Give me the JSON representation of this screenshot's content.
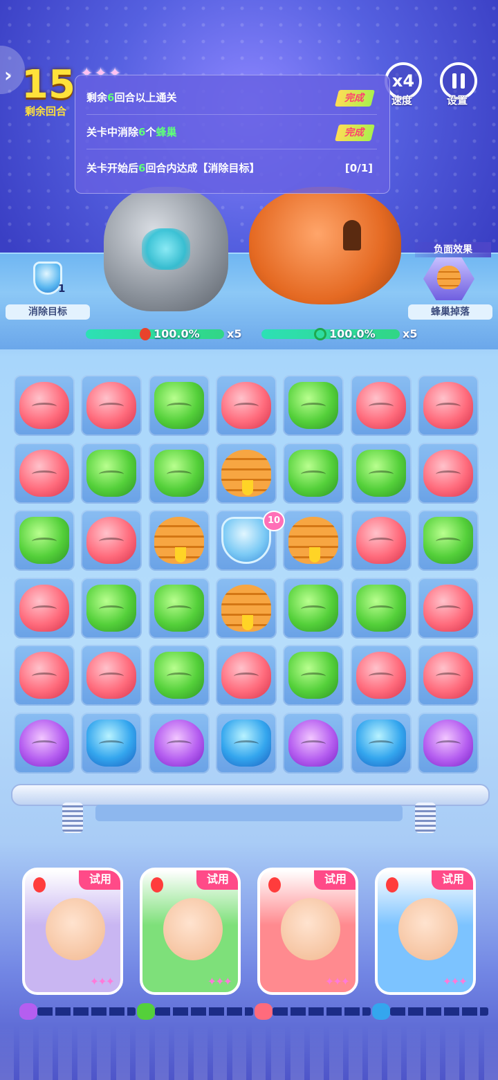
{
  "hud": {
    "turns_remaining": "15",
    "turns_label": "剩余回合",
    "speed_value": "x4",
    "speed_label": "速度",
    "settings_label": "设置"
  },
  "objectives": [
    {
      "pre": "剩余",
      "num": "6",
      "post": "回合以上通关",
      "status": "完成"
    },
    {
      "pre": "关卡中消除",
      "num": "6",
      "mid": "个",
      "hl_word": "蜂巢",
      "status": "完成"
    },
    {
      "pre": "关卡开始后",
      "num": "6",
      "post": "回合内达成【消除目标】",
      "status": "[0/1]"
    }
  ],
  "arena": {
    "left_goal_label": "消除目标",
    "left_goal_count": "1",
    "debuff_title": "负面效果",
    "debuff_label": "蜂巢掉落",
    "enemy1_hp_text": "100.0%",
    "enemy1_mult": "x5",
    "enemy1_hp_fraction": 1.0,
    "enemy2_hp_text": "100.0%",
    "enemy2_mult": "x5",
    "enemy2_hp_fraction": 1.0
  },
  "board": {
    "rows": [
      [
        "red",
        "red",
        "green",
        "red",
        "green",
        "red",
        "red"
      ],
      [
        "red",
        "green",
        "green",
        "hive",
        "green",
        "green",
        "red"
      ],
      [
        "green",
        "red",
        "hive",
        "shield",
        "hive",
        "red",
        "green"
      ],
      [
        "red",
        "green",
        "green",
        "hive",
        "green",
        "green",
        "red"
      ],
      [
        "red",
        "red",
        "green",
        "red",
        "green",
        "red",
        "red"
      ],
      [
        "purple",
        "blue",
        "purple",
        "blue",
        "purple",
        "blue",
        "purple"
      ]
    ],
    "shield_badge": "10"
  },
  "heroes": [
    {
      "trial": "试用",
      "bg": "#c9b6f2",
      "energy_icon": "purple"
    },
    {
      "trial": "试用",
      "bg": "#7ee07a",
      "energy_icon": "green"
    },
    {
      "trial": "试用",
      "bg": "#ff8a8f",
      "energy_icon": "red"
    },
    {
      "trial": "试用",
      "bg": "#7cc3ff",
      "energy_icon": "blue"
    }
  ],
  "colors": {
    "red": "#ff6b7c",
    "green": "#54d03a",
    "purple": "#b55ef0",
    "blue": "#34a6ee",
    "trial_badge": "#ff4a88",
    "turns": "#ffe23a"
  }
}
